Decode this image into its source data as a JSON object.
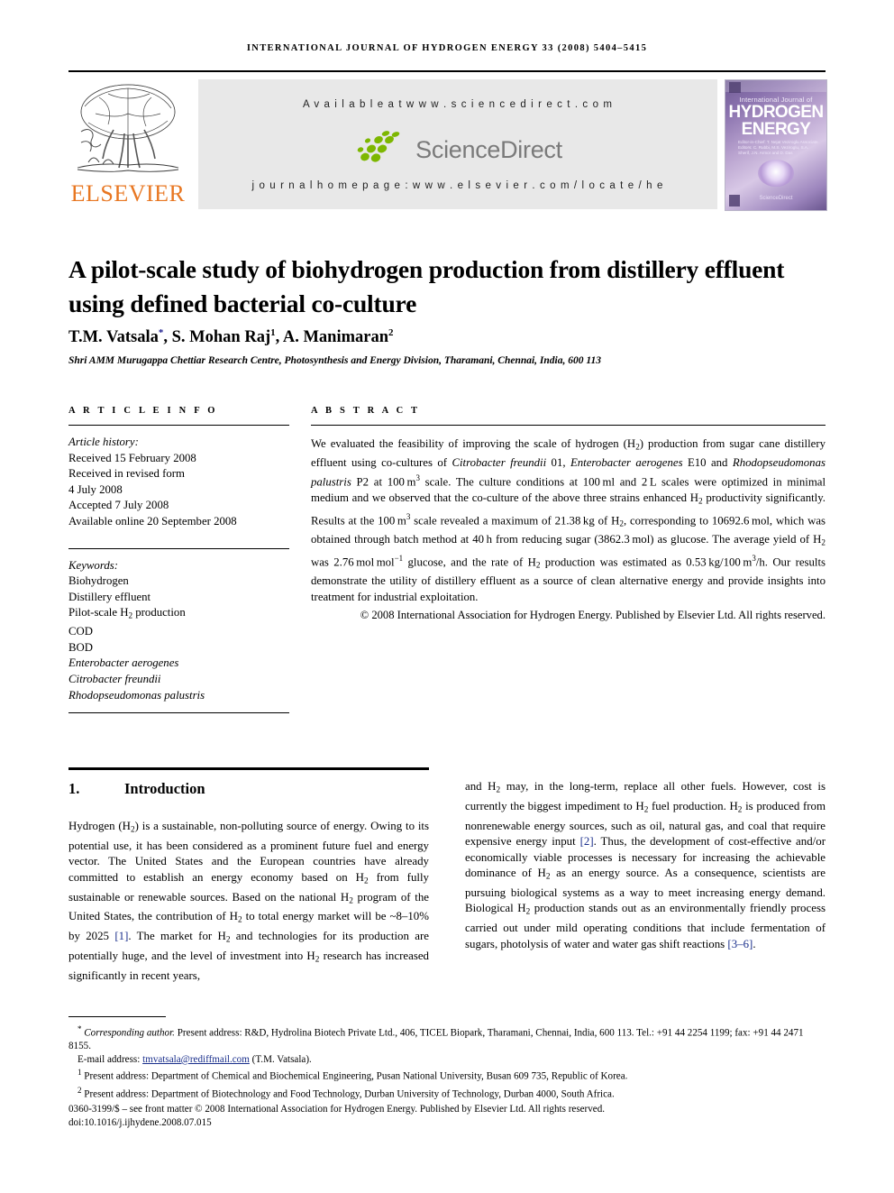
{
  "running_head": "INTERNATIONAL JOURNAL OF HYDROGEN ENERGY 33 (2008) 5404–5415",
  "masthead": {
    "publisher_wordmark": "ELSEVIER",
    "available_at": "A v a i l a b l e   a t   w w w . s c i e n c e d i r e c t . c o m",
    "sciencedirect_label": "ScienceDirect",
    "journal_homepage": "j o u r n a l   h o m e p a g e :   w w w . e l s e v i e r . c o m / l o c a t e / h e",
    "cover": {
      "line1": "International Journal of",
      "line2": "HYDROGEN",
      "line3": "ENERGY",
      "editors": "Editor-in-Chief:  T. Nejat Veziroglu\nAssociate Editors:  C. Rubbi, M.S. Veziroglu,\nS.A. Sherif, J.N. Armor\nand D. Das",
      "sciencedirect": "ScienceDirect"
    }
  },
  "title": "A pilot-scale study of biohydrogen production from distillery effluent using defined bacterial co-culture",
  "authors": {
    "a1_name": "T.M. Vatsala",
    "a1_mark": "*",
    "a2_name": ", S. Mohan Raj",
    "a2_mark": "1",
    "a3_name": ", A. Manimaran",
    "a3_mark": "2"
  },
  "affiliation": "Shri AMM Murugappa Chettiar Research Centre, Photosynthesis and Energy Division, Tharamani, Chennai, India, 600 113",
  "article_info": {
    "heading": "A R T I C L E   I N F O",
    "history_label": "Article history:",
    "history": [
      "Received 15 February 2008",
      "Received in revised form",
      "4 July 2008",
      "Accepted 7 July 2008",
      "Available online 20 September 2008"
    ],
    "keywords_label": "Keywords:",
    "keywords": [
      "Biohydrogen",
      "Distillery effluent",
      "Pilot-scale H2 production",
      "COD",
      "BOD",
      "Enterobacter aerogenes",
      "Citrobacter freundii",
      "Rhodopseudomonas palustris"
    ]
  },
  "abstract": {
    "heading": "A B S T R A C T",
    "text": "We evaluated the feasibility of improving the scale of hydrogen (H2) production from sugar cane distillery effluent using co-cultures of Citrobacter freundii 01, Enterobacter aerogenes E10 and Rhodopseudomonas palustris P2 at 100 m3 scale. The culture conditions at 100 ml and 2 L scales were optimized in minimal medium and we observed that the co-culture of the above three strains enhanced H2 productivity significantly. Results at the 100 m3 scale revealed a maximum of 21.38 kg of H2, corresponding to 10692.6 mol, which was obtained through batch method at 40 h from reducing sugar (3862.3 mol) as glucose. The average yield of H2 was 2.76 mol mol−1 glucose, and the rate of H2 production was estimated as 0.53 kg/100 m3/h. Our results demonstrate the utility of distillery effluent as a source of clean alternative energy and provide insights into treatment for industrial exploitation.",
    "copyright": "© 2008 International Association for Hydrogen Energy. Published by Elsevier Ltd. All rights reserved."
  },
  "section": {
    "number": "1.",
    "title": "Introduction",
    "left_paragraph": "Hydrogen (H2) is a sustainable, non-polluting source of energy. Owing to its potential use, it has been considered as a prominent future fuel and energy vector. The United States and the European countries have already committed to establish an energy economy based on H2 from fully sustainable or renewable sources. Based on the national H2 program of the United States, the contribution of H2 to total energy market will be ~8–10% by 2025 [1]. The market for H2 and technologies for its production are potentially huge, and the level of investment into H2 research has increased significantly in recent years,",
    "right_paragraph": "and H2 may, in the long-term, replace all other fuels. However, cost is currently the biggest impediment to H2 fuel production. H2 is produced from nonrenewable energy sources, such as oil, natural gas, and coal that require expensive energy input [2]. Thus, the development of cost-effective and/or economically viable processes is necessary for increasing the achievable dominance of H2 as an energy source. As a consequence, scientists are pursuing biological systems as a way to meet increasing energy demand. Biological H2 production stands out as an environmentally friendly process carried out under mild operating conditions that include fermentation of sugars, photolysis of water and water gas shift reactions [3–6]."
  },
  "footnotes": {
    "corresponding_mark": "*",
    "corresponding_label": "Corresponding author.",
    "corresponding_text": " Present address: R&D, Hydrolina Biotech Private Ltd., 406, TICEL Biopark, Tharamani, Chennai, India, 600 113. Tel.: +91 44 2254 1199; fax: +91 44 2471 8155.",
    "email_label": "E-mail address:",
    "email": "tmvatsala@rediffmail.com",
    "email_owner": "(T.M. Vatsala).",
    "note1_mark": "1",
    "note1": "Present address: Department of Chemical and Biochemical Engineering, Pusan National University, Busan 609 735, Republic of Korea.",
    "note2_mark": "2",
    "note2": "Present address: Department of Biotechnology and Food Technology, Durban University of Technology, Durban 4000, South Africa.",
    "front_matter": "0360-3199/$ – see front matter © 2008 International Association for Hydrogen Energy. Published by Elsevier Ltd. All rights reserved.",
    "doi": "doi:10.1016/j.ijhydene.2008.07.015"
  },
  "colors": {
    "elsevier_orange": "#E87722",
    "sciencedirect_green": "#7DB700",
    "sciencedirect_gray": "#7a7a7a",
    "link_blue": "#1a2f8c",
    "banner_gray": "#e8e8e8"
  }
}
